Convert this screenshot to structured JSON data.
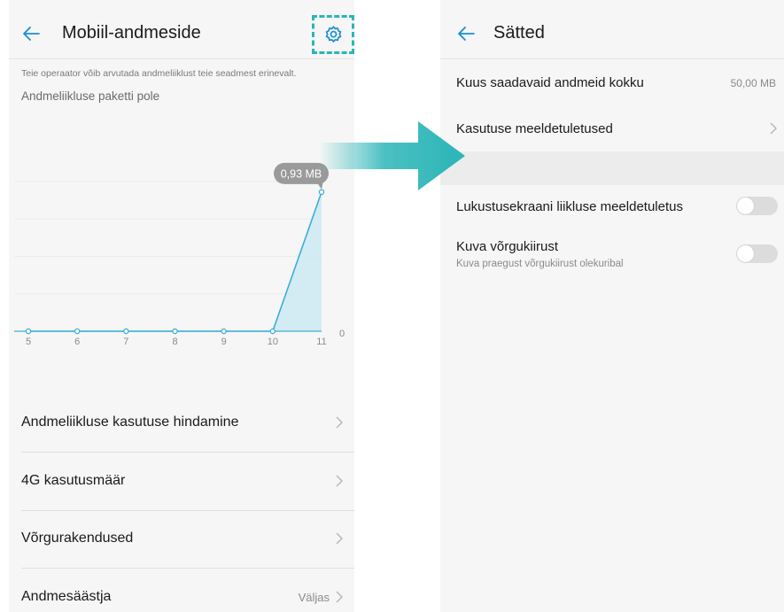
{
  "colors": {
    "accent": "#2bb5b7",
    "chart_line": "#3aaed8",
    "chart_fill": "#cde9f2"
  },
  "left_screen": {
    "title": "Mobiil-andmeside",
    "back_icon": "arrow-left-icon",
    "settings_icon": "gear-icon",
    "operator_note": "Teie operaator võib arvutada andmeliiklust teie seadmest erinevalt.",
    "plan_note": "Andmeliikluse paketti pole",
    "list": [
      {
        "label": "Andmeliikluse kasutuse hindamine",
        "value": ""
      },
      {
        "label": "4G kasutusmäär",
        "value": ""
      },
      {
        "label": "Võrgurakendused",
        "value": ""
      },
      {
        "label": "Andmesäästja",
        "value": "Väljas"
      }
    ]
  },
  "right_screen": {
    "title": "Sätted",
    "back_icon": "arrow-left-icon",
    "total_label": "Kuus saadavaid andmeid kokku",
    "total_value": "50,00 MB",
    "reminders_label": "Kasutuse meeldetuletused",
    "lockscreen_label": "Lukustusekraani liikluse meeldetuletus",
    "lockscreen_enabled": false,
    "speed_label": "Kuva võrgukiirust",
    "speed_sub": "Kuva praegust võrgukiirust olekuribal",
    "speed_enabled": false
  },
  "chart_data": {
    "type": "area",
    "x": [
      "5",
      "6",
      "7",
      "8",
      "9",
      "10",
      "11"
    ],
    "values": [
      0,
      0,
      0,
      0,
      0,
      0,
      0.93
    ],
    "value_unit": "MB",
    "callout_label": "0,93 MB",
    "y_axis_zero_label": "0",
    "ylim": [
      0,
      1.0
    ],
    "grid": true,
    "title": "",
    "xlabel": "",
    "ylabel": ""
  }
}
